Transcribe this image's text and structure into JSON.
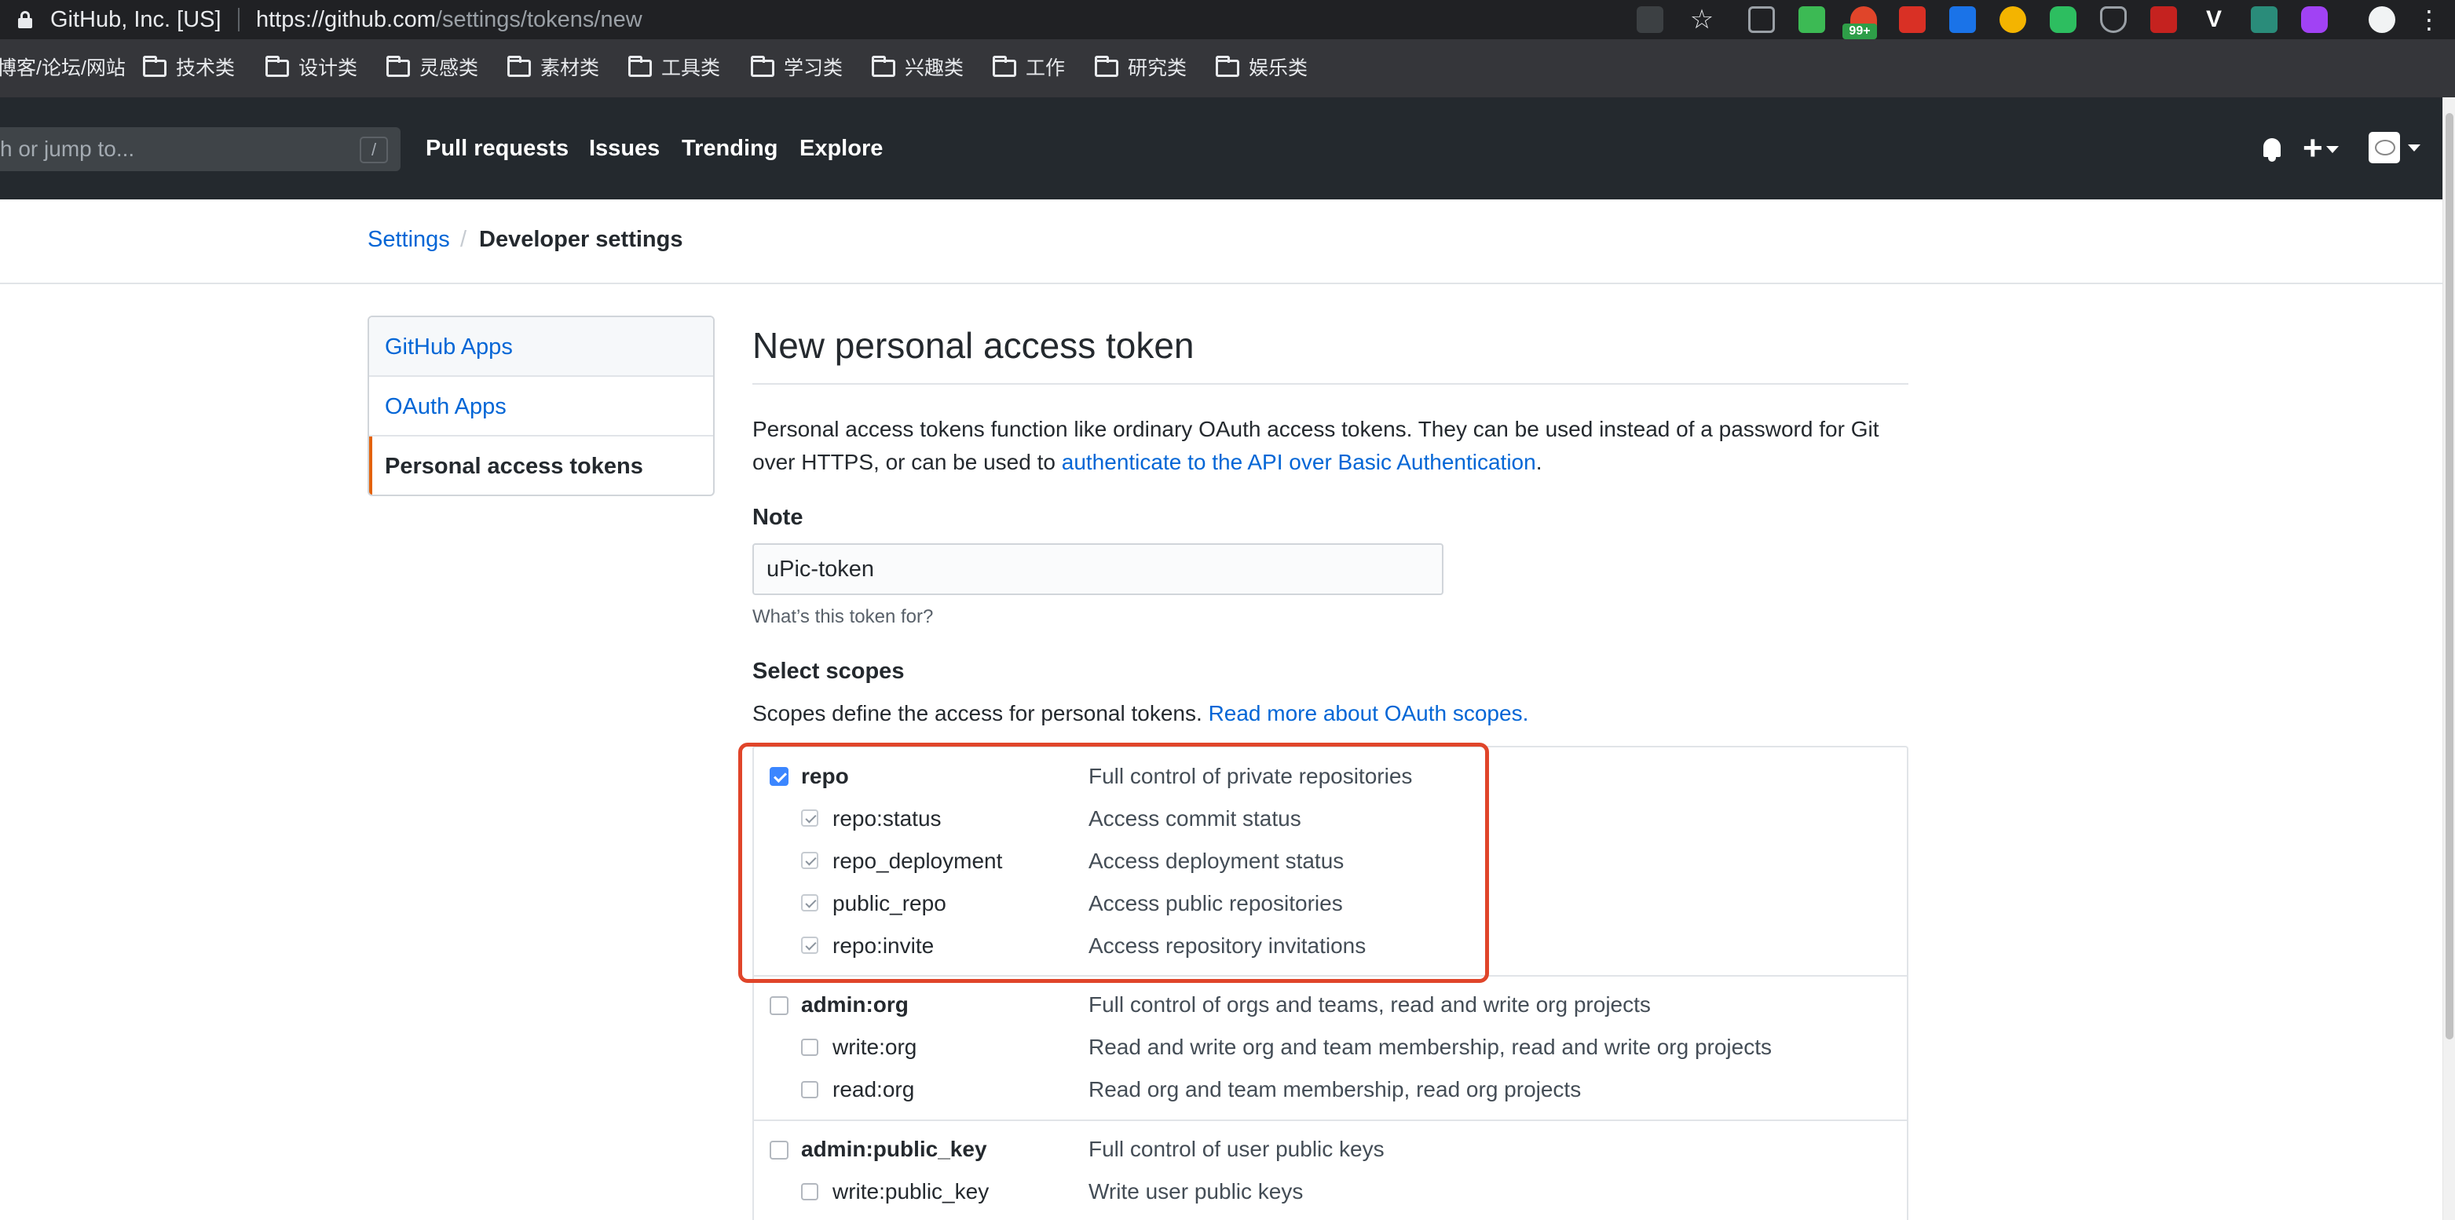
{
  "browser": {
    "site_identity": "GitHub, Inc. [US]",
    "url_host": "https://github.com",
    "url_path": "/settings/tokens/new",
    "extension_badge": "99+",
    "bookmarks": [
      "博客/论坛/网站",
      "技术类",
      "设计类",
      "灵感类",
      "素材类",
      "工具类",
      "学习类",
      "兴趣类",
      "工作",
      "研究类",
      "娱乐类"
    ]
  },
  "header": {
    "search_placeholder": "h or jump to...",
    "search_shortcut": "/",
    "nav": [
      "Pull requests",
      "Issues",
      "Trending",
      "Explore"
    ],
    "plus": "+"
  },
  "breadcrumb": {
    "parent": "Settings",
    "divider": "/",
    "current": "Developer settings"
  },
  "sidebar": {
    "items": [
      {
        "label": "GitHub Apps"
      },
      {
        "label": "OAuth Apps"
      },
      {
        "label": "Personal access tokens"
      }
    ]
  },
  "main": {
    "title": "New personal access token",
    "description_prefix": "Personal access tokens function like ordinary OAuth access tokens. They can be used instead of a password for Git over HTTPS, or can be used to ",
    "description_link": "authenticate to the API over Basic Authentication",
    "description_suffix": ".",
    "note_label": "Note",
    "note_value": "uPic-token",
    "note_hint": "What’s this token for?",
    "scopes_label": "Select scopes",
    "scopes_description": "Scopes define the access for personal tokens. ",
    "scopes_link": "Read more about OAuth scopes.",
    "scopes": [
      {
        "name": "repo",
        "description": "Full control of private repositories",
        "checked": true,
        "children": [
          {
            "name": "repo:status",
            "description": "Access commit status"
          },
          {
            "name": "repo_deployment",
            "description": "Access deployment status"
          },
          {
            "name": "public_repo",
            "description": "Access public repositories"
          },
          {
            "name": "repo:invite",
            "description": "Access repository invitations"
          }
        ]
      },
      {
        "name": "admin:org",
        "description": "Full control of orgs and teams, read and write org projects",
        "checked": false,
        "children": [
          {
            "name": "write:org",
            "description": "Read and write org and team membership, read and write org projects"
          },
          {
            "name": "read:org",
            "description": "Read org and team membership, read org projects"
          }
        ]
      },
      {
        "name": "admin:public_key",
        "description": "Full control of user public keys",
        "checked": false,
        "children": [
          {
            "name": "write:public_key",
            "description": "Write user public keys"
          }
        ]
      }
    ]
  },
  "colors": {
    "link": "#0366d6",
    "header_bg": "#24292e",
    "selected_accent": "#e36209",
    "highlight_box": "#e0452a",
    "checkbox_checked": "#3b86ff"
  }
}
